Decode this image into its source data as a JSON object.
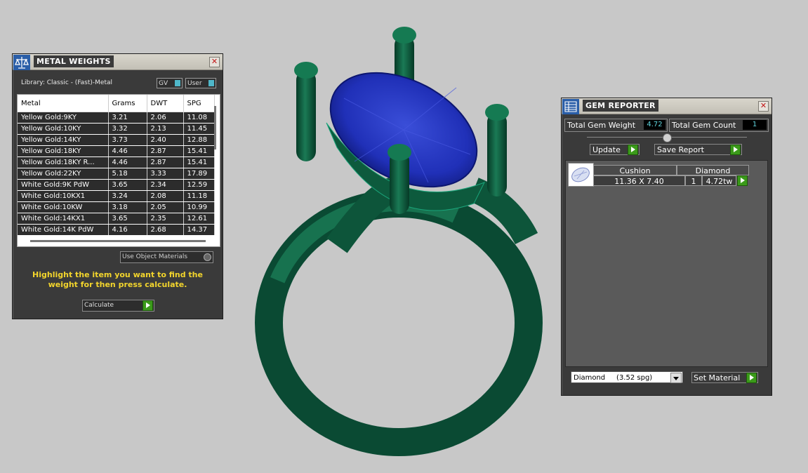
{
  "metal_weights": {
    "title": "METAL WEIGHTS",
    "library": "Library: Classic - (Fast)-Metal",
    "toggles": {
      "gv": "GV",
      "user": "User"
    },
    "columns": [
      "Metal",
      "Grams",
      "DWT",
      "SPG"
    ],
    "rows": [
      [
        "Yellow Gold:9KY",
        "3.21",
        "2.06",
        "11.08"
      ],
      [
        "Yellow Gold:10KY",
        "3.32",
        "2.13",
        "11.45"
      ],
      [
        "Yellow Gold:14KY",
        "3.73",
        "2.40",
        "12.88"
      ],
      [
        "Yellow Gold:18KY",
        "4.46",
        "2.87",
        "15.41"
      ],
      [
        "Yellow Gold:18KY R...",
        "4.46",
        "2.87",
        "15.41"
      ],
      [
        "Yellow Gold:22KY",
        "5.18",
        "3.33",
        "17.89"
      ],
      [
        "White Gold:9K PdW",
        "3.65",
        "2.34",
        "12.59"
      ],
      [
        "White Gold:10KX1",
        "3.24",
        "2.08",
        "11.18"
      ],
      [
        "White Gold:10KW",
        "3.18",
        "2.05",
        "10.99"
      ],
      [
        "White Gold:14KX1",
        "3.65",
        "2.35",
        "12.61"
      ],
      [
        "White Gold:14K PdW",
        "4.16",
        "2.68",
        "14.37"
      ]
    ],
    "use_object_materials": "Use Object Materials",
    "hint": "Highlight the item you want to find the weight for then press calculate.",
    "calculate": "Calculate"
  },
  "gem_reporter": {
    "title": "GEM REPORTER",
    "total_gem_weight_label": "Total Gem Weight",
    "total_gem_weight": "4.72",
    "total_gem_count_label": "Total Gem Count",
    "total_gem_count": "1",
    "update": "Update",
    "save_report": "Save Report",
    "gem": {
      "cut": "Cushion",
      "material": "Diamond",
      "size": "11.36 X 7.40",
      "count": "1",
      "weight": "4.72tw"
    },
    "material_select": "Diamond     (3.52 spg)",
    "set_material": "Set Material"
  },
  "colors": {
    "ring_metal": "#0f5c40",
    "gem": "#1f2fb0",
    "panel": "#3a3a3a",
    "hint": "#f3d52c",
    "accent_value": "#5fd3dd"
  }
}
